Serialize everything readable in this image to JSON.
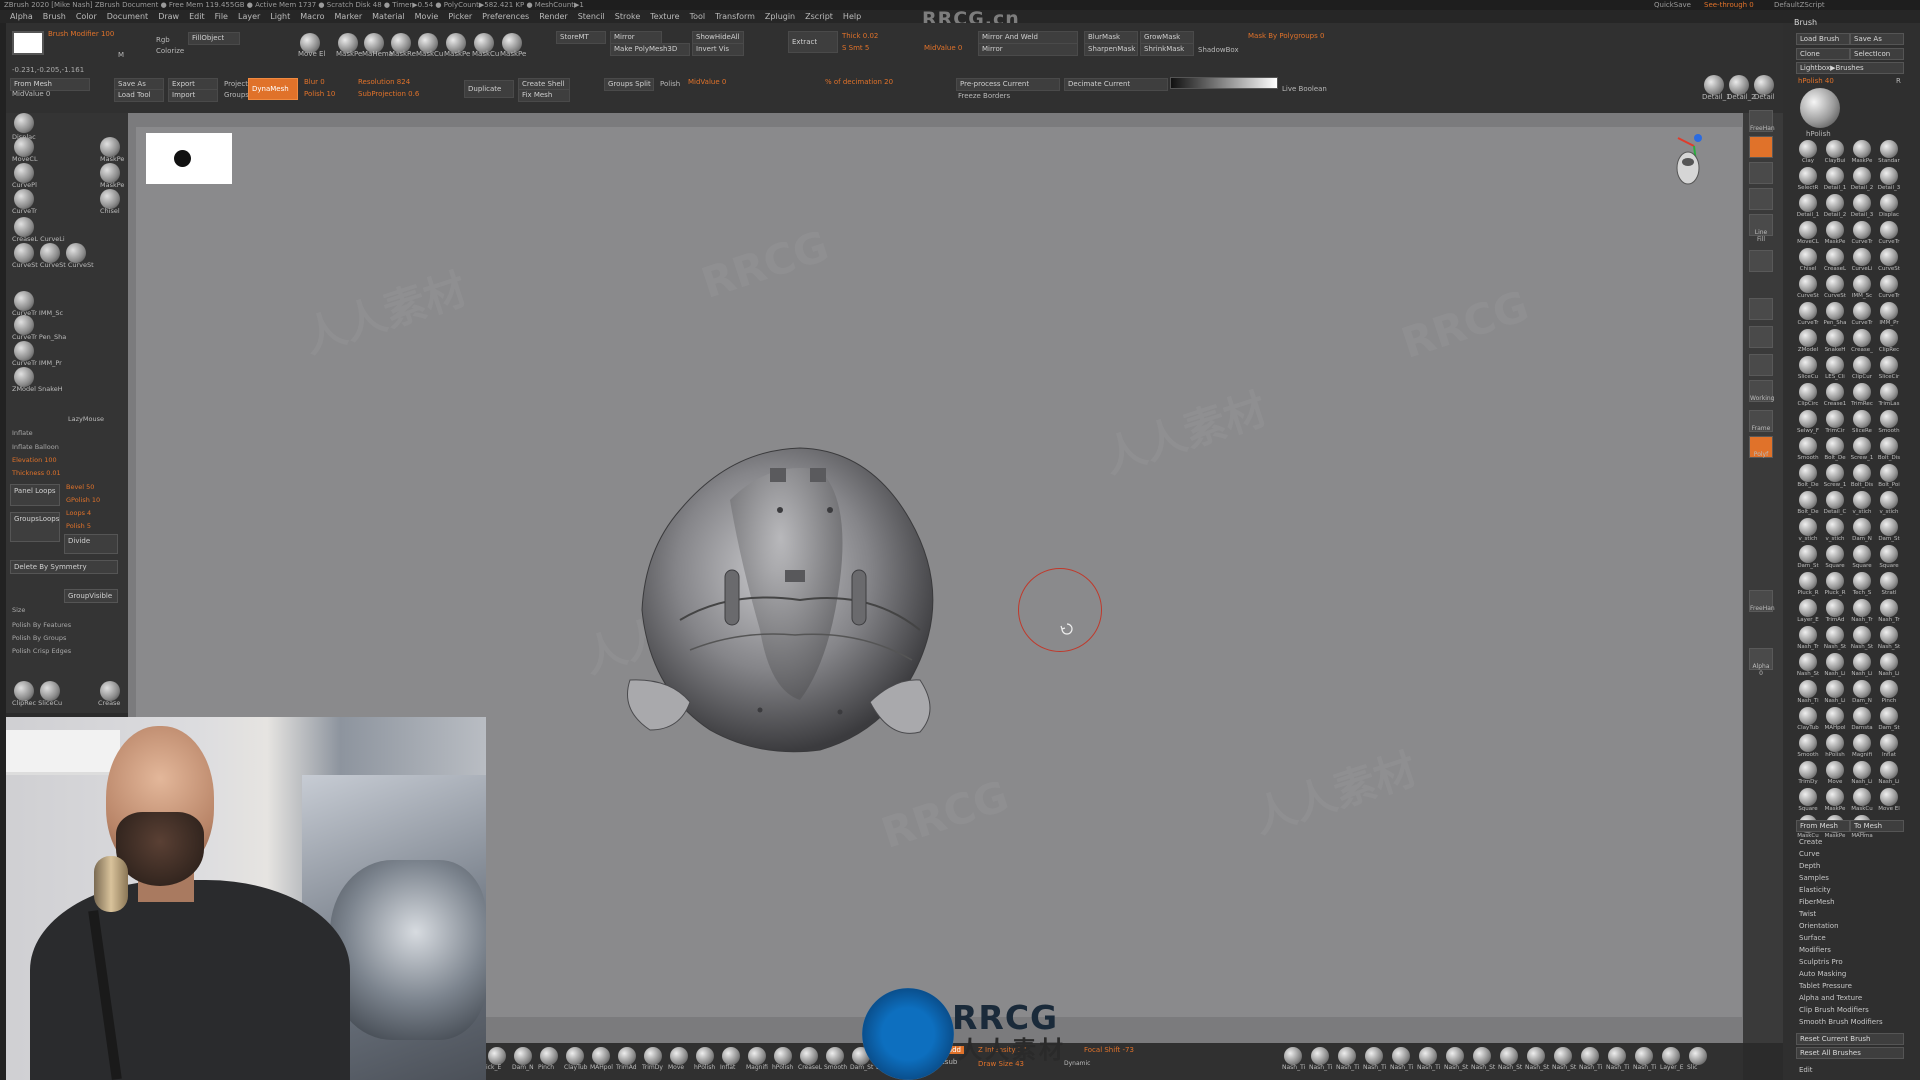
{
  "titlebar": {
    "text": "ZBrush 2020 [Mike Nash]  ZBrush Document    ● Free Mem 119.455GB ● Active Mem 1737 ● Scratch Disk 48 ● Timer▶0.54 ● PolyCount▶582.421 KP ● MeshCount▶1",
    "quicksave": "QuickSave",
    "seethrough": "See-through  0",
    "script": "DefaultZScript"
  },
  "menu": {
    "items": [
      "Alpha",
      "Brush",
      "Color",
      "Document",
      "Draw",
      "Edit",
      "File",
      "Layer",
      "Light",
      "Macro",
      "Marker",
      "Material",
      "Movie",
      "Picker",
      "Preferences",
      "Render",
      "Stencil",
      "Stroke",
      "Texture",
      "Tool",
      "Transform",
      "Zplugin",
      "Zscript",
      "Help"
    ],
    "brand": "RRCG.cn"
  },
  "toolbar": {
    "brush_modifier": "Brush Modifier 100",
    "rgb": "Rgb",
    "fill_object": "FillObject",
    "colorize": "Colorize",
    "coords": "-0.231,-0.205,-1.161",
    "m_label": "M",
    "from_mesh": "From Mesh",
    "midvalue_left": "MidValue 0",
    "save_as": "Save As",
    "export": "Export",
    "load_tool": "Load Tool",
    "import": "Import",
    "project": "Project",
    "groups": "Groups",
    "dynamesh": "DynaMesh",
    "blur": "Blur 0",
    "polish": "Polish 10",
    "resolution": "Resolution 824",
    "subprojection": "SubProjection 0.6",
    "duplicate": "Duplicate",
    "create_shell": "Create Shell",
    "fix_mesh": "Fix Mesh",
    "groups_split": "Groups Split",
    "polish2": "Polish",
    "midvalue2": "MidValue 0",
    "pct_decimation": "% of decimation 20",
    "preprocess": "Pre-process Current",
    "decimate": "Decimate Current",
    "freeze_borders": "Freeze Borders",
    "live_boolean": "Live Boolean",
    "storemt": "StoreMT",
    "mirror": "Mirror",
    "show_hide_all": "ShowHideAll",
    "make_polymesh": "Make PolyMesh3D",
    "invert_vis": "Invert Vis",
    "extract": "Extract",
    "thick": "Thick 0.02",
    "s_smt": "S Smt 5",
    "midvalue3": "MidValue 0",
    "mirror_weld": "Mirror And Weld",
    "mirror2": "Mirror",
    "blurmask": "BlurMask",
    "growmask": "GrowMask",
    "sharpenmask": "SharpenMask",
    "shrinkmask": "ShrinkMask",
    "shadowbox": "ShadowBox",
    "mask_by_polygroups": "Mask By Polygroups 0",
    "tool_icons": [
      "Move El",
      "MaskPe",
      "MaHema",
      "MaskRe",
      "MaskCu",
      "MaskPe",
      "MaskCu",
      "MaskPe"
    ],
    "right_icons": [
      "Detail_1",
      "Detail_2",
      "Detail"
    ]
  },
  "leftpanel": {
    "top_icons": [
      {
        "label": "Displac"
      },
      {
        "label": "MoveCL"
      },
      {
        "label": "MaskPe"
      },
      {
        "label": "CurvePl"
      },
      {
        "label": "MaskPe"
      },
      {
        "label": "CurveTr"
      },
      {
        "label": "Chisel"
      },
      {
        "label": "CreaseL CurveLi"
      },
      {
        "label": "CurveSt CurveSt CurveSt"
      },
      {
        "label": "CurveTr IMM_Sc"
      },
      {
        "label": "CurveTr Pen_Sha"
      },
      {
        "label": "CurveTr IMM_Pr"
      },
      {
        "label": "ZModel SnakeH"
      }
    ],
    "lazymouse": "LazyMouse",
    "inflate": "Inflate",
    "inflate_balloon": "Inflate Balloon",
    "elevation": "Elevation 100",
    "thickness": "Thickness 0.01",
    "panel_loops": "Panel Loops",
    "bevel": "Bevel 50",
    "gpolish": "GPolish 10",
    "loops": "Loops 4",
    "polish": "Polish 5",
    "groups_loops": "GroupsLoops",
    "divide": "Divide",
    "delete_by_symmetry": "Delete By Symmetry",
    "group_visible": "GroupVisible",
    "size": "Size",
    "polish_by_features": "Polish By Features",
    "polish_by_groups": "Polish By Groups",
    "polish_crisp_edges": "Polish Crisp Edges",
    "bottom_icons": [
      "ClipRec SliceCu",
      "Crease"
    ]
  },
  "rightstrip": {
    "buttons": [
      "FreeHan",
      "",
      "",
      "",
      "Line Fill",
      "",
      "",
      "",
      "",
      "",
      "Working",
      "Frame",
      "Polyf",
      "",
      "",
      "",
      "FreeHan",
      "Alpha 0"
    ],
    "active_index": 1
  },
  "brushpanel": {
    "title": "Brush",
    "load_brush": "Load Brush",
    "save_as": "Save As",
    "clone": "Clone",
    "select_icon": "SelectIcon",
    "lightbox_brushes": "Lightbox▶Brushes",
    "hpolish": "hPolish 40",
    "r_label": "R",
    "current_brush": "hPolish",
    "brushes": [
      "Clay",
      "ClayBui",
      "MaskPe",
      "Standar",
      "SelectR",
      "Detail_1",
      "Detail_2",
      "Detail_3",
      "Detail_1",
      "Detail_2",
      "Detail_3",
      "Displac",
      "MoveCL",
      "MaskPe",
      "CurveTr",
      "CurveTr",
      "Chisel",
      "CreaseL",
      "CurveLi",
      "CurveSt",
      "CurveSt",
      "CurveSt",
      "IMM_Sc",
      "CurveTr",
      "CurveTr",
      "Pen_Sha",
      "CurveTr",
      "IMM_Pr",
      "ZModel",
      "SnakeH",
      "Crease_",
      "ClipRec",
      "SliceCu",
      "LES_Cli",
      "ClipCur",
      "SliceCir",
      "ClipCirc",
      "Crease1",
      "TrimRec",
      "TrimLas",
      "Selwy_F",
      "TrimCir",
      "SliceRe",
      "Smooth",
      "Smooth",
      "Bolt_De",
      "Screw_1",
      "Bolt_Dis",
      "Bolt_De",
      "Screw_1",
      "Bolt_Dis",
      "Bolt_Poi",
      "Bolt_De",
      "Detail_C",
      "v_stich",
      "v_stich",
      "v_stich",
      "v_stich",
      "Dam_N",
      "Dam_St",
      "Dam_St",
      "Square",
      "Square",
      "Square",
      "Pluck_R",
      "Pluck_R",
      "Tech_S",
      "Stratl",
      "Layer_E",
      "TrimAd",
      "Nash_Tr",
      "Nash_Tr",
      "Nash_Tr",
      "Nash_St",
      "Nash_St",
      "Nash_St",
      "Nash_St",
      "Nash_Li",
      "Nash_Li",
      "Nash_Li",
      "Nash_Ti",
      "Nash_Li",
      "Dam_N",
      "Pinch",
      "ClayTub",
      "MAHpol",
      "Damsta",
      "Dam_St",
      "Smooth",
      "hPolish",
      "Magnifi",
      "Inflat",
      "TrimDy",
      "Move",
      "Nash_Li",
      "Nash_Li",
      "Square",
      "MaskPe",
      "MaskCu",
      "Move El",
      "MaskCu",
      "MaskPe",
      "MAHma"
    ],
    "from_mesh": "From Mesh",
    "to_mesh": "To Mesh",
    "sections": [
      "Create",
      "Curve",
      "Depth",
      "Samples",
      "Elasticity",
      "FiberMesh",
      "Twist",
      "Orientation",
      "Surface",
      "Modifiers",
      "Sculptris Pro",
      "Auto Masking",
      "Tablet Pressure",
      "Alpha and Texture",
      "Clip Brush Modifiers",
      "Smooth Brush Modifiers"
    ],
    "reset_current": "Reset Current Brush",
    "reset_all": "Reset All Brushes",
    "edit": "Edit"
  },
  "bottombar": {
    "brushes": [
      "ick_E",
      "Dam_N",
      "Pinch",
      "ClayTub",
      "MAHpol",
      "TrimAd",
      "TrimDy",
      "Move",
      "hPolish",
      "Inflat",
      "Magnifi",
      "hPolish",
      "CreaseL",
      "Smooth",
      "Dam_St",
      "Damsta",
      "Standar"
    ],
    "right_brushes": [
      "Nash_Ti",
      "Nash_Ti",
      "Nash_Ti",
      "Nash_Ti",
      "Nash_Ti",
      "Nash_Ti",
      "Nash_St",
      "Nash_St",
      "Nash_St",
      "Nash_St",
      "Nash_St",
      "Nash_Ti",
      "Nash_Ti",
      "Nash_Ti",
      "Layer_E",
      "Slic"
    ],
    "zadd": "Zadd",
    "zsub": "Zsub",
    "z_intensity": "Z Intensity 37",
    "draw_size": "Draw Size 43",
    "focal_shift": "Focal Shift -73",
    "dynamic": "Dynamic"
  },
  "watermark": {
    "logo_text": "RRCG",
    "logo_sub": "人人素材",
    "tiles": [
      "RRCG",
      "人人素材"
    ]
  },
  "colors": {
    "accent": "#e0722a",
    "viewport_bg": "#8a8a8c",
    "panel_bg": "#303030",
    "cursor_ring": "#c0392b"
  }
}
